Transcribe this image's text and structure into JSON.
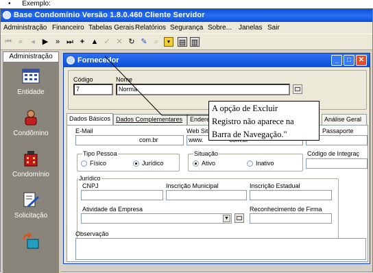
{
  "caption": {
    "bullet": "•",
    "text": "Exemplo:"
  },
  "window": {
    "title": "Base Condomínio Versão 1.8.0.460 Cliente Servidor"
  },
  "menu": [
    "Administração",
    "Financeiro",
    "Tabelas Gerais",
    "Relatórios",
    "Segurança",
    "Sobre...",
    "Janelas",
    "Sair"
  ],
  "sidebar": {
    "tab_label": "Administração",
    "items": [
      {
        "label": "Entidade",
        "icon": "calendar-grid-icon"
      },
      {
        "label": "Condômino",
        "icon": "person-icon"
      },
      {
        "label": "Condomínio",
        "icon": "building-icon"
      },
      {
        "label": "Solicitação",
        "icon": "document-pen-icon"
      },
      {
        "label": "",
        "icon": "box-arrow-icon"
      }
    ]
  },
  "form": {
    "title": "Fornecedor",
    "codigo_label": "Código",
    "codigo_value": "7",
    "nome_label": "Nome",
    "nome_value": "Norma",
    "tabs": [
      "Dados Básicos",
      "Dados Complementares",
      "Endere",
      "Análise Geral"
    ],
    "email_label": "E-Mail",
    "email_value": "com.br",
    "website_label": "Web Sit",
    "website_value_prefix": "www.",
    "website_value_suffix": "com.br",
    "passaporte_label": "Passaporte",
    "tipo_pessoa_label": "Tipo Pessoa",
    "tipo_pessoa_options": [
      "Físico",
      "Jurídico"
    ],
    "tipo_pessoa_selected": "Jurídico",
    "situacao_label": "Situação",
    "situacao_options": [
      "Ativo",
      "Inativo"
    ],
    "situacao_selected": "Ativo",
    "codigo_integracao_label": "Código de Integraç",
    "juridico_label": "Jurídico",
    "cnpj_label": "CNPJ",
    "inscricao_municipal_label": "Inscrição Municipal",
    "inscricao_estadual_label": "Inscrição Estadual",
    "atividade_label": "Atividade da Empresa",
    "reconhecimento_label": "Reconhecimento de Firma",
    "observacao_label": "Observação"
  },
  "callout": {
    "lines": [
      "A opção de Excluir",
      "Registro não aparece na",
      "Barra de Navegação.\""
    ]
  }
}
